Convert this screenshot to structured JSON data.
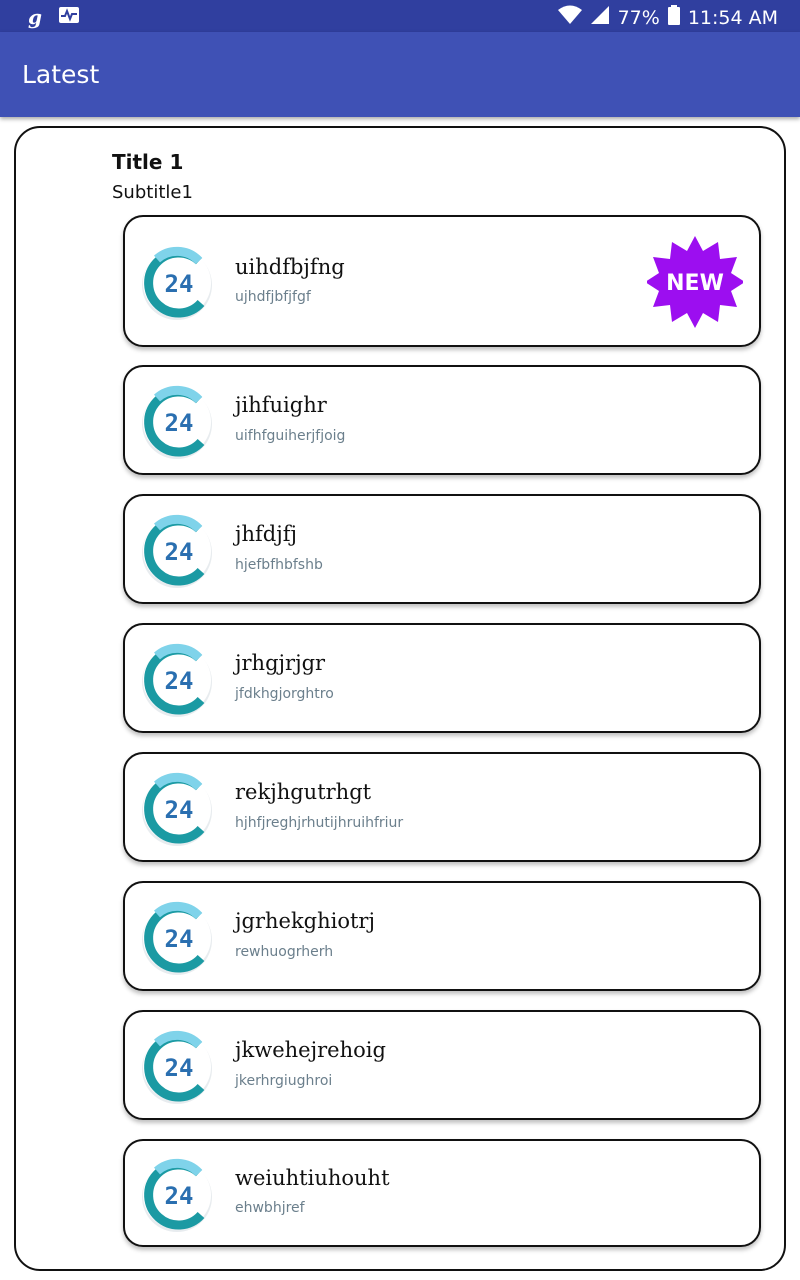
{
  "status_bar": {
    "battery": "77%",
    "time": "11:54 AM",
    "icons": [
      "g-app-icon",
      "pulse-icon",
      "wifi-icon",
      "signal-icon",
      "battery-icon"
    ]
  },
  "app_bar": {
    "title": "Latest"
  },
  "section": {
    "title": "Title 1",
    "subtitle": "Subtitle1"
  },
  "items": [
    {
      "title": "uihdfbjfng",
      "subtitle": "ujhdfjbfjfgf",
      "badge": "NEW"
    },
    {
      "title": "jihfuighr",
      "subtitle": "uifhfguiherjfjoig"
    },
    {
      "title": "jhfdjfj",
      "subtitle": "hjefbfhbfshb"
    },
    {
      "title": "jrhgjrjgr",
      "subtitle": "jfdkhgjorghtro"
    },
    {
      "title": "rekjhgutrhgt",
      "subtitle": "hjhfjreghjrhutijhruihfriur"
    },
    {
      "title": "jgrhekghiotrj",
      "subtitle": "rewhuogrherh"
    },
    {
      "title": "jkwehejrehoig",
      "subtitle": "jkerhrgiughroi"
    },
    {
      "title": "weiuhtiuhouht",
      "subtitle": "ehwbhjref"
    }
  ],
  "logo_text": "24",
  "colors": {
    "status_bar": "#303f9f",
    "app_bar": "#3f51b5",
    "badge": "#9c0ef0",
    "logo_teal": "#1b9aa3",
    "logo_light": "#7fd3ea"
  }
}
